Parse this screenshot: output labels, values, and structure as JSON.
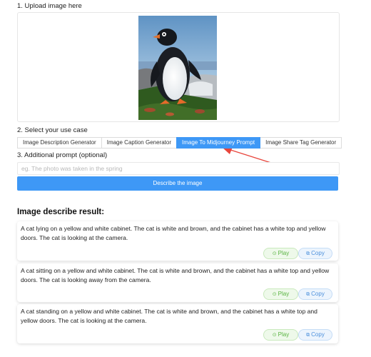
{
  "steps": {
    "upload_label": "1. Upload image here",
    "usecase_label": "2. Select your use case",
    "prompt_label": "3. Additional prompt (optional)"
  },
  "tabs": [
    {
      "label": "Image Description Generator",
      "active": false
    },
    {
      "label": "Image Caption Generator",
      "active": false
    },
    {
      "label": "Image To Midjourney Prompt",
      "active": true
    },
    {
      "label": "Image Share Tag Generator",
      "active": false
    }
  ],
  "prompt": {
    "placeholder": "eg. The photo was taken in the spring",
    "value": ""
  },
  "describe_button": "Describe the image",
  "results": {
    "title": "Image describe result:",
    "items": [
      {
        "text": "A cat lying on a yellow and white cabinet. The cat is white and brown, and the cabinet has a white top and yellow doors. The cat is looking at the camera.",
        "play": "Play",
        "copy": "Copy"
      },
      {
        "text": "A cat sitting on a yellow and white cabinet. The cat is white and brown, and the cabinet has a white top and yellow doors. The cat is looking away from the camera.",
        "play": "Play",
        "copy": "Copy"
      },
      {
        "text": "A cat standing on a yellow and white cabinet. The cat is white and brown, and the cabinet has a white top and yellow doors. The cat is looking at the camera.",
        "play": "Play",
        "copy": "Copy"
      }
    ]
  },
  "colors": {
    "accent": "#3e98f6",
    "annotation_arrow": "#e8453c",
    "play_green": "#59b341",
    "copy_blue": "#4c90dc"
  },
  "icons": {
    "play": "play-circle-icon",
    "copy": "copy-icon"
  }
}
